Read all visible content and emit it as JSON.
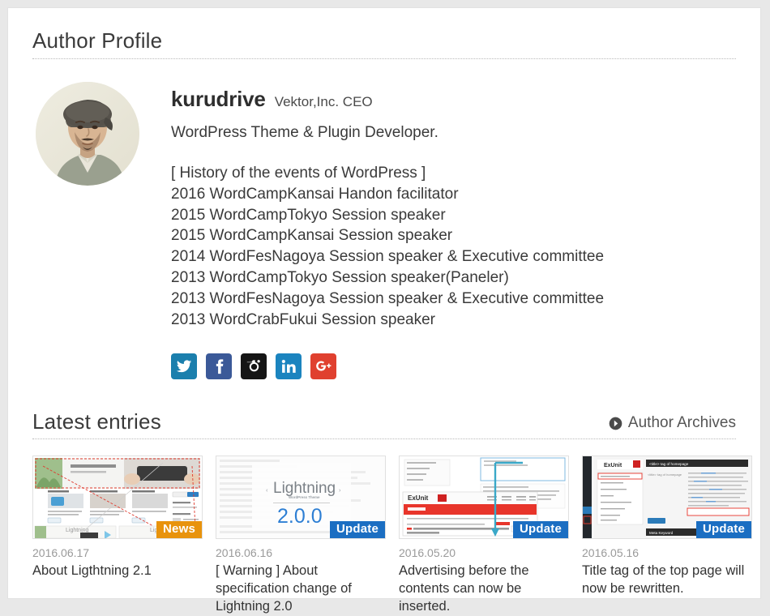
{
  "profile_section": {
    "heading": "Author Profile",
    "author": {
      "name": "kurudrive",
      "role": "Vektor,Inc. CEO",
      "tagline": "WordPress Theme & Plugin Developer.",
      "avatar_alt": "author-portrait"
    },
    "bio_lines": [
      "[ History of the events of WordPress ]",
      "2016 WordCampKansai Handon facilitator",
      "2015 WordCampTokyo Session speaker",
      "2015 WordCampKansai Session speaker",
      "2014 WordFesNagoya Session speaker & Executive committee",
      "2013 WordCampTokyo Session speaker(Paneler)",
      "2013 WordFesNagoya Session speaker & Executive committee",
      "2013 WordCrabFukui Session speaker"
    ],
    "socials": [
      {
        "icon": "twitter-icon",
        "label": "Twitter",
        "color": "#1b7fad"
      },
      {
        "icon": "facebook-icon",
        "label": "Facebook",
        "color": "#3b5998"
      },
      {
        "icon": "instagram-icon",
        "label": "Instagram",
        "color": "#151515"
      },
      {
        "icon": "linkedin-icon",
        "label": "LinkedIn",
        "color": "#1b84bf"
      },
      {
        "icon": "google-plus-icon",
        "label": "Google Plus",
        "color": "#e0402f"
      }
    ]
  },
  "latest_section": {
    "heading": "Latest entries",
    "archives_label": "Author Archives",
    "archives_icon": "circle-chevron-right-icon",
    "entries": [
      {
        "date": "2016.06.17",
        "title": "About Ligthtning 2.1",
        "badge": "News",
        "badge_color": "#e8930c",
        "thumb": "lightning-21-screenshot"
      },
      {
        "date": "2016.06.16",
        "title": "[ Warning ] About specification change of Lightning 2.0",
        "badge": "Update",
        "badge_color": "#1b6ec2",
        "thumb": "lightning-200-splash"
      },
      {
        "date": "2016.05.20",
        "title": "Advertising before the contents can now be inserted.",
        "badge": "Update",
        "badge_color": "#1b6ec2",
        "thumb": "exunit-ad-screenshot"
      },
      {
        "date": "2016.05.16",
        "title": "Title tag of the top page will now be rewritten.",
        "badge": "Update",
        "badge_color": "#1b6ec2",
        "thumb": "exunit-title-tag-screenshot"
      }
    ]
  }
}
